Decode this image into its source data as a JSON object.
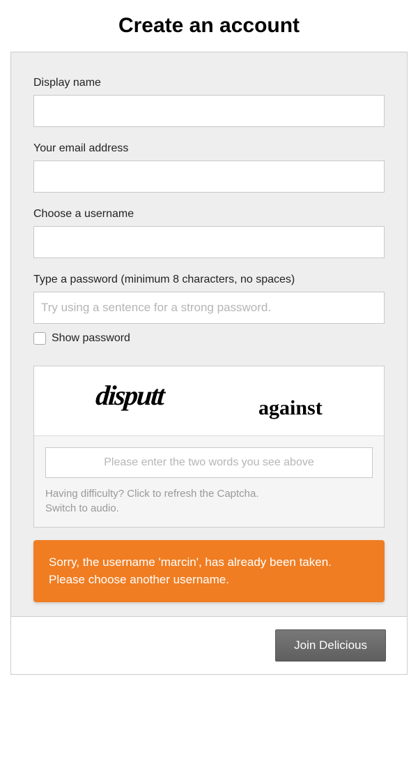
{
  "title": "Create an account",
  "fields": {
    "display_name": {
      "label": "Display name",
      "value": ""
    },
    "email": {
      "label": "Your email address",
      "value": ""
    },
    "username": {
      "label": "Choose a username",
      "value": ""
    },
    "password": {
      "label": "Type a password (minimum 8 characters, no spaces)",
      "placeholder": "Try using a sentence for a strong password.",
      "value": ""
    },
    "show_password": {
      "label": "Show password",
      "checked": false
    }
  },
  "captcha": {
    "word1": "disputt",
    "word2": "against",
    "input_placeholder": "Please enter the two words you see above",
    "input_value": "",
    "help_refresh": "Having difficulty? Click to refresh the Captcha.",
    "help_audio": "Switch to audio."
  },
  "error": {
    "message": "Sorry, the username 'marcin', has already been taken. Please choose another username."
  },
  "footer": {
    "submit_label": "Join Delicious"
  }
}
